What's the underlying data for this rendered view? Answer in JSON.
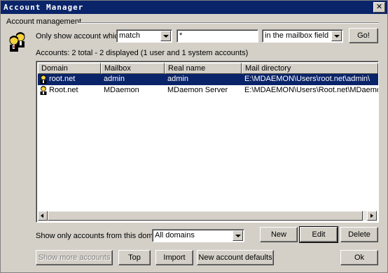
{
  "window": {
    "title": "Account Manager",
    "close_glyph": "✕"
  },
  "group": {
    "label": "Account management"
  },
  "filter": {
    "label": "Only show account which",
    "match_value": "match",
    "pattern_value": "*",
    "field_value": "in the mailbox field",
    "go_label": "Go!"
  },
  "summary": "Accounts:  2 total - 2 displayed (1 user and 1 system accounts)",
  "columns": [
    "Domain",
    "Mailbox",
    "Real name",
    "Mail directory"
  ],
  "rows": [
    {
      "domain": "root.net",
      "mailbox": "admin",
      "real_name": "admin",
      "mail_dir": "E:\\MDAEMON\\Users\\root.net\\admin\\",
      "selected": true
    },
    {
      "domain": "Root.net",
      "mailbox": "MDaemon",
      "real_name": "MDaemon Server",
      "mail_dir": "E:\\MDAEMON\\Users\\Root.net\\MDaemon\\",
      "selected": false
    }
  ],
  "domain_filter": {
    "label": "Show only accounts from this domain",
    "value": "All domains"
  },
  "buttons": {
    "new": "New",
    "edit": "Edit",
    "delete": "Delete",
    "more": "Show more accounts",
    "top": "Top",
    "import": "Import",
    "defaults": "New account defaults",
    "ok": "Ok"
  },
  "icons": {
    "group": "users-icon",
    "row": "user-account-icon"
  },
  "colors": {
    "titlebar": "#0a246a",
    "selection": "#0a246a",
    "face": "#d4d0c8"
  }
}
